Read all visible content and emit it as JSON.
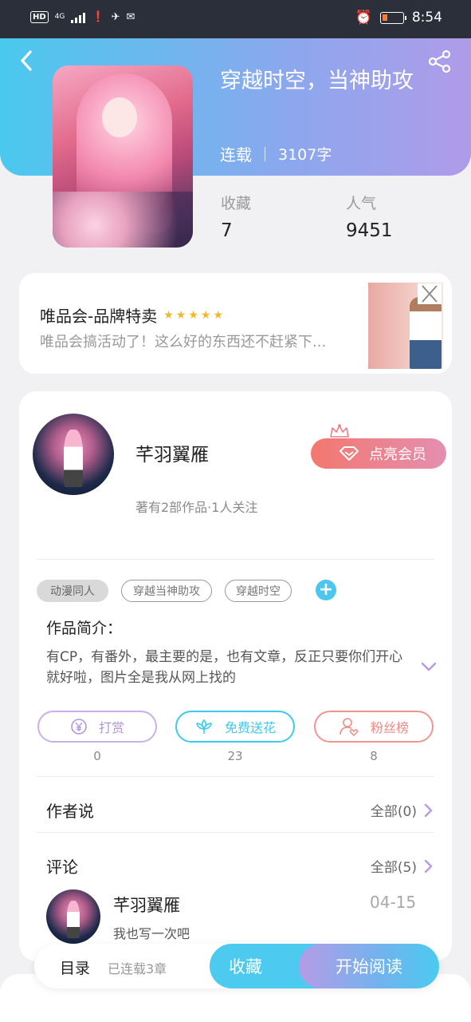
{
  "status_bar": {
    "hd": "HD",
    "network": "4G",
    "time": "8:54"
  },
  "header": {
    "title": "穿越时空，当神助攻",
    "status": "连载",
    "word_count": "3107字",
    "favorites_label": "收藏",
    "favorites_value": "7",
    "popularity_label": "人气",
    "popularity_value": "9451"
  },
  "ad": {
    "title": "唯品会-品牌特卖",
    "stars": 5,
    "description": "唯品会搞活动了！这么好的东西还不赶紧下..."
  },
  "author": {
    "name": "芊羽翼雁",
    "meta": "著有2部作品·1人关注",
    "vip_button": "点亮会员"
  },
  "tags": [
    "动漫同人",
    "穿越当神助攻",
    "穿越时空"
  ],
  "intro": {
    "label": "作品简介：",
    "text": "有CP，有番外，最主要的是，也有文章，反正只要你们开心就好啦，图片全是我从网上找的"
  },
  "actions": [
    {
      "label": "打赏",
      "count": "0",
      "color": "#b495dd"
    },
    {
      "label": "免费送花",
      "count": "23",
      "color": "#3ccbee"
    },
    {
      "label": "粉丝榜",
      "count": "8",
      "color": "#ef8a86"
    }
  ],
  "author_says": {
    "label": "作者说",
    "all": "全部(0)"
  },
  "comments": {
    "label": "评论",
    "all": "全部(5)",
    "items": [
      {
        "name": "芊羽翼雁",
        "date": "04-15",
        "text": "我也写一次吧"
      }
    ]
  },
  "bottom_bar": {
    "toc": "目录",
    "chapters": "已连载3章",
    "favorite": "收藏",
    "start_reading": "开始阅读"
  },
  "colors": {
    "accent_blue": "#4ccaf0",
    "accent_purple": "#b09be9",
    "vip_red": "#f3776e",
    "chevron": "#b79be6"
  }
}
